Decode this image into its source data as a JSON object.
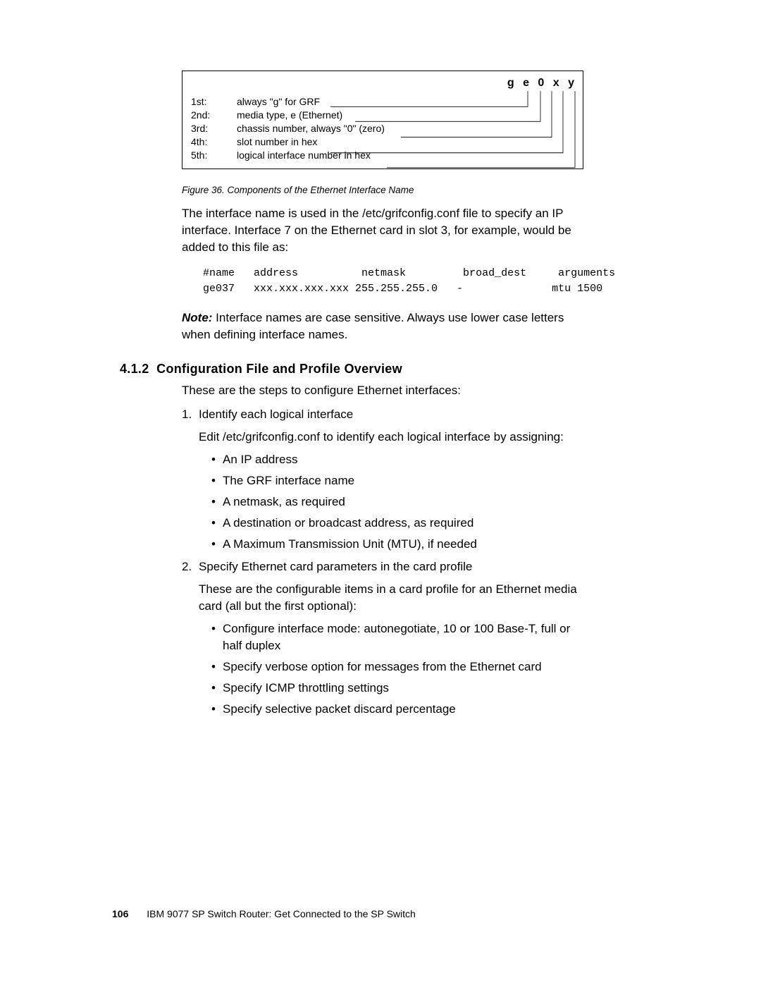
{
  "diagram": {
    "header": "g e 0 x y",
    "rows": [
      {
        "label": "1st:",
        "desc": "always \"g\" for GRF"
      },
      {
        "label": "2nd:",
        "desc": "media type, e (Ethernet)"
      },
      {
        "label": "3rd:",
        "desc": "chassis number, always \"0\" (zero)"
      },
      {
        "label": "4th:",
        "desc": "slot number in hex"
      },
      {
        "label": "5th:",
        "desc": "logical interface number in hex"
      }
    ]
  },
  "figure_caption": "Figure 36.  Components of the Ethernet Interface Name",
  "para_intro": "The interface name is used in the /etc/grifconfig.conf file to specify an IP interface. Interface 7 on the Ethernet card in slot 3, for example, would be added to this file as:",
  "code_line1": "#name   address          netmask         broad_dest     arguments",
  "code_line2": "ge037   xxx.xxx.xxx.xxx 255.255.255.0   -              mtu 1500",
  "note_label": "Note:",
  "note_text": " Interface names are case sensitive. Always use lower case letters when defining interface names.",
  "section": {
    "number": "4.1.2",
    "title": "Configuration File and Profile Overview"
  },
  "section_intro": "These are the steps to configure Ethernet interfaces:",
  "step1": {
    "num": "1.",
    "title": "Identify each logical interface",
    "desc": "Edit /etc/grifconfig.conf to identify each logical interface by assigning:",
    "bullets": [
      "An IP address",
      "The GRF interface name",
      "A netmask, as required",
      "A destination or broadcast address, as required",
      "A Maximum Transmission Unit (MTU), if needed"
    ]
  },
  "step2": {
    "num": "2.",
    "title": "Specify Ethernet card parameters in the card profile",
    "desc": "These are the configurable items in a card profile for an Ethernet media card (all but the first optional):",
    "bullets": [
      "Configure interface mode: autonegotiate, 10 or 100 Base-T, full or half duplex",
      "Specify verbose option for messages from the Ethernet card",
      "Specify ICMP throttling settings",
      "Specify selective packet discard percentage"
    ]
  },
  "footer": {
    "page": "106",
    "text": "IBM 9077 SP Switch Router: Get Connected to the SP Switch"
  }
}
